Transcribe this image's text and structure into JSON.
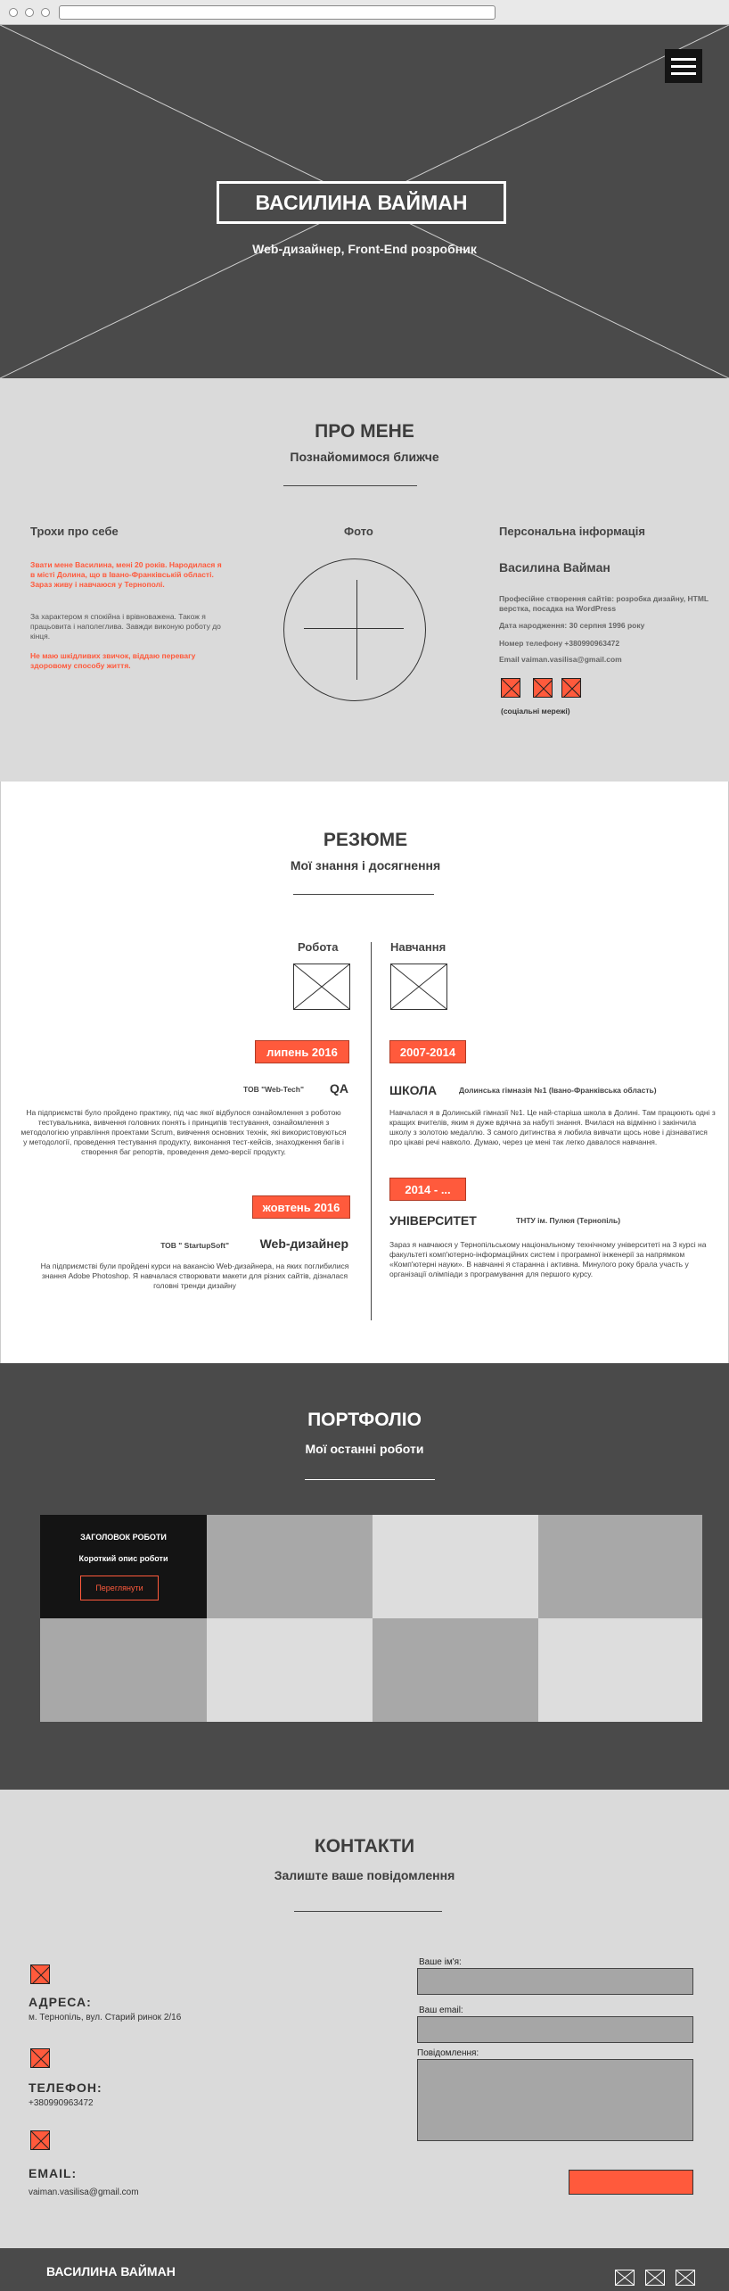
{
  "hero": {
    "name": "ВАСИЛИНА ВАЙМАН",
    "subtitle": "Web-дизайнер, Front-End розробник"
  },
  "about": {
    "title": "ПРО МЕНЕ",
    "subtitle": "Познайомимося ближче",
    "left_heading": "Трохи про себе",
    "left_p1": "Звати мене Василина, мені 20 років. Народилася я в місті Долина, що в Івано-Франківській області. Зараз живу і навчаюся у Тернополі.",
    "left_p2": "За характером я спокійна і врівноважена. Також я працьовита і наполеглива. Завжди виконую роботу до кінця.",
    "left_p3": "Не маю шкідливих звичок, віддаю перевагу здоровому способу життя.",
    "photo_heading": "Фото",
    "right_heading": "Персональна інформація",
    "person_name": "Василина Вайман",
    "skills": "Професійне створення сайтів: розробка дизайну, HTML верстка, посадка на WordPress",
    "birth": "Дата народження: 30 серпня 1996 року",
    "phone": "Номер телефону +380990963472",
    "email": "Email vaiman.vasilisa@gmail.com",
    "social_caption": "(соціальні мережі)"
  },
  "resume": {
    "title": "РЕЗЮМЕ",
    "subtitle": "Мої знання і досягнення",
    "work_heading": "Робота",
    "edu_heading": "Навчання",
    "work": [
      {
        "date": "липень 2016",
        "company": "ТОВ \"Web-Tech\"",
        "role": "QA",
        "text": "На підприємстві було пройдено практику, під час якої відбулося ознайомлення з роботою тестувальника, вивчення головних понять і принципів тестування, ознайомлення з методологією управління проектами Scrum, вивчення основних технік, які використовуються у методології, проведення тестування продукту, виконання тест-кейсів, знаходження багів і створення баг репортів, проведення демо-версії продукту."
      },
      {
        "date": "жовтень 2016",
        "company": "ТОВ \" StartupSoft\"",
        "role": "Web-дизайнер",
        "text": "На підприємстві були пройдені курси на вакансію Web-дизайнера, на яких поглибилися знання Adobe Photoshop. Я навчалася створювати макети для різних сайтів, дізналася головні тренди дизайну"
      }
    ],
    "education": [
      {
        "date": "2007-2014",
        "kind": "ШКОЛА",
        "place": "Долинська гімназія №1 (Івано-Франківська область)",
        "text": "Навчалася я в Долинській гімназії №1. Це най-старіша школа в Долині. Там працюють одні з кращих вчителів, яким я дуже вдячна за набуті знання. Вчилася на відмінно і закінчила школу з золотою медаллю. З самого дитинства я любила вивчати щось нове і дізнаватися про цікаві речі навколо. Думаю, через це мені так легко давалося навчання."
      },
      {
        "date": "2014 - ...",
        "kind": "УНІВЕРСИТЕТ",
        "place": "ТНТУ ім. Пулюя (Тернопіль)",
        "text": "Зараз я навчаюся у Тернопільському національному технічному університеті на 3 курсі на факультеті комп'ютерно-інформаційних систем і програмної інженерії за напрямком «Комп'ютерні науки». В навчанні я старанна і активна. Минулого року брала участь у організації олімпіади з програмування для першого курсу."
      }
    ]
  },
  "portfolio": {
    "title": "ПОРТФОЛІО",
    "subtitle": "Мої останні роботи",
    "card_title": "ЗАГОЛОВОК РОБОТИ",
    "card_desc": "Короткий опис роботи",
    "card_button": "Переглянути"
  },
  "contacts": {
    "title": "КОНТАКТИ",
    "subtitle": "Залиште ваше повідомлення",
    "address_h": "АДРЕСА:",
    "address_v": "м. Тернопіль, вул. Старий ринок 2/16",
    "phone_h": "ТЕЛЕФОН:",
    "phone_v": "+380990963472",
    "email_h": "EMAIL:",
    "email_v": "vaiman.vasilisa@gmail.com",
    "name_label": "Ваше ім'я:",
    "email_label": "Ваш email:",
    "message_label": "Повідомлення:"
  },
  "footer": {
    "name": "ВАСИЛИНА ВАЙМАН"
  },
  "colors": {
    "accent": "#ff5a3c",
    "dark": "#4a4a4a",
    "light": "#dadada"
  }
}
